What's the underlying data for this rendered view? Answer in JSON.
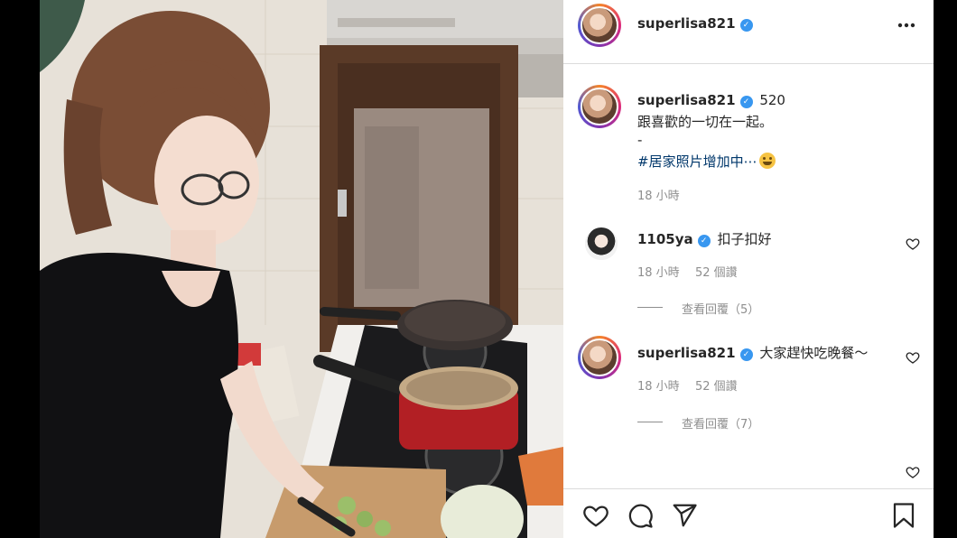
{
  "post": {
    "author": "superlisa821",
    "more_icon": "ellipsis-icon"
  },
  "caption": {
    "username": "superlisa821",
    "inline_text": "520",
    "line1": "跟喜歡的一切在一起。",
    "line2": "-",
    "hashtag": "#居家照片增加中⋯",
    "time": "18 小時"
  },
  "comments": [
    {
      "username": "1105ya",
      "text": "扣子扣好",
      "time": "18 小時",
      "likes": "52 個讚",
      "view_replies": "查看回覆（5）"
    },
    {
      "username": "superlisa821",
      "text": "大家趕快吃晚餐～",
      "time": "18 小時",
      "likes": "52 個讚",
      "view_replies": "查看回覆（7）"
    }
  ],
  "actions": {
    "icons": [
      "heart-icon",
      "comment-icon",
      "share-icon",
      "bookmark-icon"
    ]
  },
  "colors": {
    "verified": "#3897f0",
    "text": "#262626",
    "secondary": "#8e8e8e",
    "hashtag": "#00376b"
  }
}
